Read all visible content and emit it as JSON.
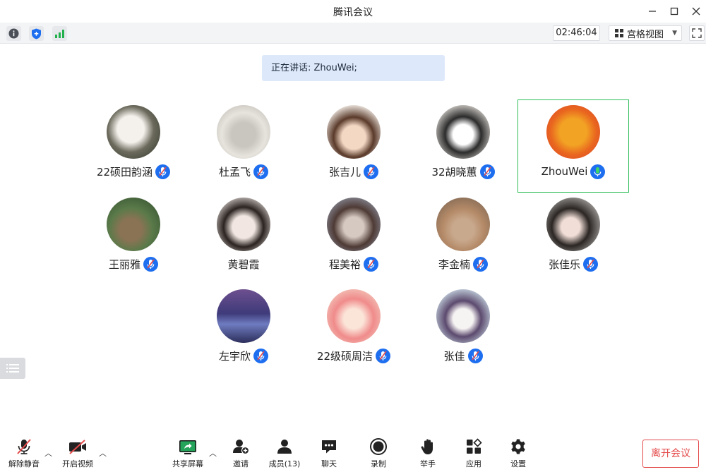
{
  "window": {
    "title": "腾讯会议"
  },
  "toolbar": {
    "timer": "02:46:04",
    "view_mode": "宫格视图"
  },
  "speaking": {
    "text": "正在讲话: ZhouWei;"
  },
  "colors": {
    "accent_blue": "#1e6ef0",
    "active_green": "#2fbf59",
    "leave_red": "#e44a4a"
  },
  "participants": [
    {
      "name": "22硕田韵涵",
      "mic": "muted"
    },
    {
      "name": "杜孟飞",
      "mic": "muted"
    },
    {
      "name": "张吉儿",
      "mic": "muted"
    },
    {
      "name": "32胡晓蕙",
      "mic": "muted"
    },
    {
      "name": "ZhouWei",
      "mic": "speaking",
      "active": true
    },
    {
      "name": "王丽雅",
      "mic": "muted"
    },
    {
      "name": "黄碧霞",
      "mic": "none"
    },
    {
      "name": "程美裕",
      "mic": "muted"
    },
    {
      "name": "李金楠",
      "mic": "muted"
    },
    {
      "name": "张佳乐",
      "mic": "muted"
    },
    {
      "name": "左宇欣",
      "mic": "muted"
    },
    {
      "name": "22级硕周洁",
      "mic": "muted"
    },
    {
      "name": "张佳",
      "mic": "muted"
    }
  ],
  "bottombar": {
    "unmute": "解除静音",
    "start_video": "开启视频",
    "share_screen": "共享屏幕",
    "invite": "邀请",
    "members": "成员(13)",
    "chat": "聊天",
    "record": "录制",
    "raise_hand": "举手",
    "apps": "应用",
    "settings": "设置",
    "leave": "离开会议"
  }
}
